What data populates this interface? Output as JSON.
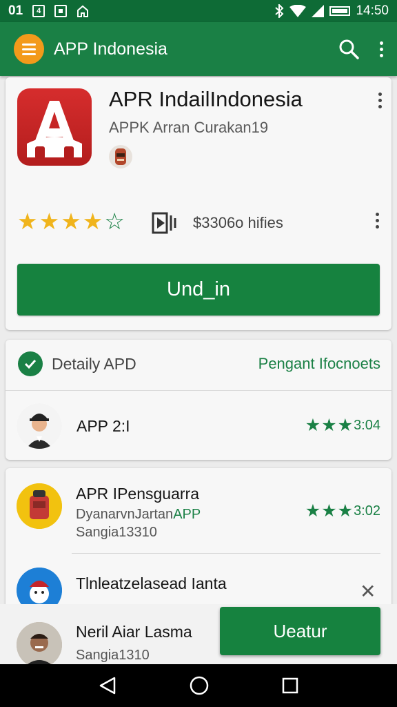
{
  "status_bar": {
    "left_items": [
      "01",
      "4",
      "",
      ""
    ],
    "time": "14:50",
    "icons": [
      "bluetooth-icon",
      "wifi-icon",
      "signal-icon",
      "battery-icon"
    ]
  },
  "app_bar": {
    "title": "APP Indonesia",
    "icons": [
      "menu-icon",
      "search-icon",
      "more-vert-icon"
    ],
    "accent": "#1a8045",
    "menu_color": "#f39a1b"
  },
  "app_card": {
    "title": "APR IndailIndonesia",
    "subtitle": "APPK Arran Curakan19",
    "rating_stars": 4,
    "install_count": "$3306o hifies",
    "primary_button": "Und_in"
  },
  "details_card": {
    "title": "Detaily APD",
    "link": "Pengant Ifocnoets",
    "rows": [
      {
        "name": "APP 2:I",
        "rating_stars": 3,
        "rating_value": "3:04"
      }
    ]
  },
  "list_card": {
    "items": [
      {
        "name": "APR IPensguarra",
        "meta_line1": "DyanarvnJartan",
        "meta_badge": "APP",
        "meta_line2": "Sangia13310",
        "rating_stars": 3,
        "rating_value": "3:02"
      },
      {
        "name": "Tlnleatzelasead Ianta"
      },
      {
        "name": "Neril Aiar Lasma",
        "meta_line2": "Sangia1310"
      }
    ],
    "install_button": "Ueatur"
  },
  "nav_bar": {
    "icons": [
      "back-icon",
      "home-icon",
      "recents-icon"
    ]
  }
}
